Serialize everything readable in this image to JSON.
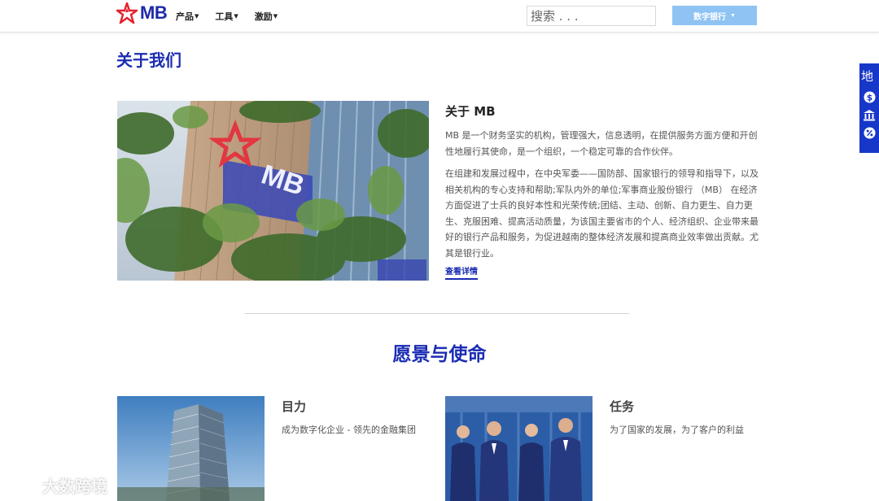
{
  "header": {
    "logo_text": "MB",
    "nav": [
      {
        "label": "产品"
      },
      {
        "label": "工具"
      },
      {
        "label": "激励"
      }
    ],
    "search_placeholder": "搜索 . . .",
    "digital_bank_label": "数字银行"
  },
  "side_tab": {
    "label": "地",
    "icons": [
      "dollar-icon",
      "bank-icon",
      "percent-icon"
    ]
  },
  "about": {
    "page_title": "关于我们",
    "heading": "关于 MB",
    "paragraph1": "MB 是一个财务坚实的机构，管理强大，信息透明，在提供服务方面方便和开创性地履行其使命，是一个组织，一个稳定可靠的合作伙伴。",
    "paragraph2": "在组建和发展过程中，在中央军委——国防部、国家银行的领导和指导下，以及相关机构的专心支持和帮助;军队内外的单位;军事商业股份银行 （MB） 在经济方面促进了士兵的良好本性和光荣传统;团结、主动、创新、自力更生、自力更生、克服困难、提高活动质量，为该国主要省市的个人、经济组织、企业带来最好的银行产品和服务，为促进越南的整体经济发展和提高商业效率做出贡献。尤其是银行业。",
    "details_link": "查看详情"
  },
  "vision": {
    "title": "愿景与使命",
    "cards": [
      {
        "title": "目力",
        "text": "成为数字化企业 - 领先的金融集团"
      },
      {
        "title": "任务",
        "text": "为了国家的发展，为了客户的利益"
      }
    ]
  },
  "watermark": {
    "text": "大数跨境"
  },
  "colors": {
    "brand_blue": "#1a2cb3",
    "brand_red": "#e4212b",
    "button_light_blue": "#8fc3f3",
    "side_tab_blue": "#1737c8"
  }
}
